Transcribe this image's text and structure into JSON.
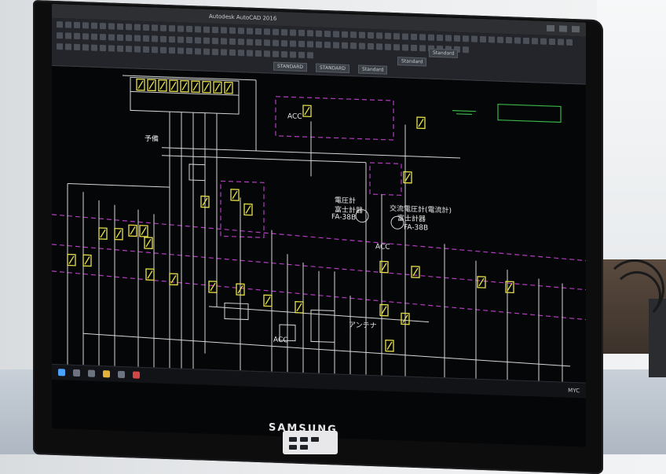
{
  "scene": {
    "description_type": "photo of monitor showing CAD electrical diagram",
    "colors": {
      "screen_bg": "#050607",
      "line": "#d7d7d7",
      "yellow": "#e7e04a",
      "magenta": "#b43cc2",
      "green": "#39b54a"
    }
  },
  "monitor": {
    "brand": "SAMSUNG"
  },
  "cad": {
    "title": "Autodesk AutoCAD 2016",
    "toolbar_dropdowns": [
      "STANDARD",
      "STANDARD",
      "Standard",
      "Standard",
      "Standard"
    ],
    "labels": {
      "acc_1": "ACC",
      "acc_2": "ACC",
      "acc_3": "ACC",
      "meter_left_line1": "電圧計",
      "meter_left_line2": "富士計器",
      "meter_left_model": "FA-38B",
      "meter_right_line1": "交流電圧計(電流計)",
      "meter_right_line2": "富士計器",
      "meter_right_model": "FA-38B",
      "spare": "予備",
      "antenna": "アンテナ"
    }
  },
  "taskbar": {
    "tray_text": "MYC"
  }
}
